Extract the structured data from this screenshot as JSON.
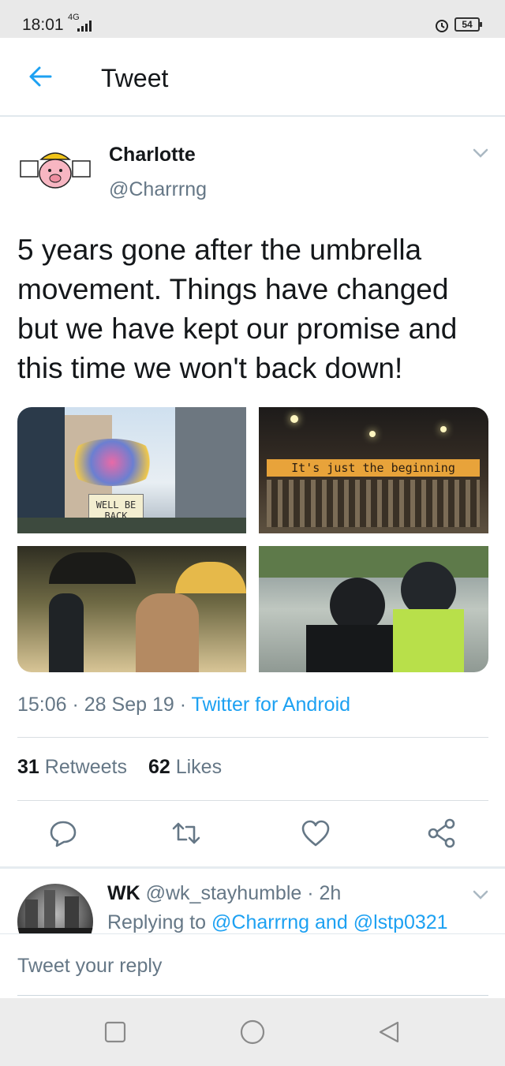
{
  "status_bar": {
    "time": "18:01",
    "network": "4G",
    "battery": "54"
  },
  "header": {
    "title": "Tweet",
    "back_icon": "arrow-left-icon"
  },
  "tweet": {
    "author_name": "Charlotte",
    "author_handle": "@Charrrng",
    "text": "5 years gone after the umbrella movement. Things have changed but we have kept our promise and this time we won't back down!",
    "media": [
      {
        "banner_text": "WELL BE BACK"
      },
      {
        "banner_text": "It's just the beginning"
      },
      {
        "banner_text": ""
      },
      {
        "banner_text": ""
      }
    ],
    "time": "15:06",
    "date": "28 Sep 19",
    "source": "Twitter for Android",
    "retweets_count": "31",
    "retweets_label": "Retweets",
    "likes_count": "62",
    "likes_label": "Likes"
  },
  "actions": [
    "reply-icon",
    "retweet-icon",
    "like-icon",
    "share-icon"
  ],
  "reply": {
    "name": "WK",
    "handle": "@wk_stayhumble",
    "time": "2h",
    "replying_prefix": "Replying to",
    "mention_1": "@Charrrng",
    "conjunction": "and",
    "mention_2": "@lstp0321"
  },
  "compose": {
    "placeholder": "Tweet your reply"
  },
  "colors": {
    "accent": "#1da1f2",
    "secondary_text": "#657786",
    "primary_text": "#14171a"
  }
}
